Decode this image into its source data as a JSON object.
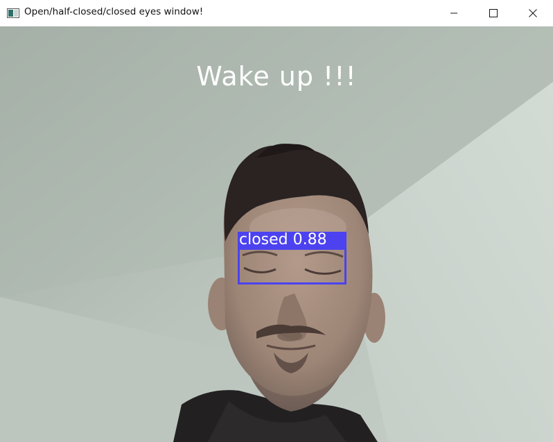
{
  "window": {
    "title": "Open/half-closed/closed eyes window!",
    "controls": {
      "minimize_icon": "minimize-icon",
      "maximize_icon": "maximize-icon",
      "close_icon": "close-icon"
    }
  },
  "overlay": {
    "message": "Wake up !!!",
    "message_color": "#ffffff"
  },
  "detection": {
    "label": "closed 0.88",
    "box_color": "#4c42f0"
  }
}
